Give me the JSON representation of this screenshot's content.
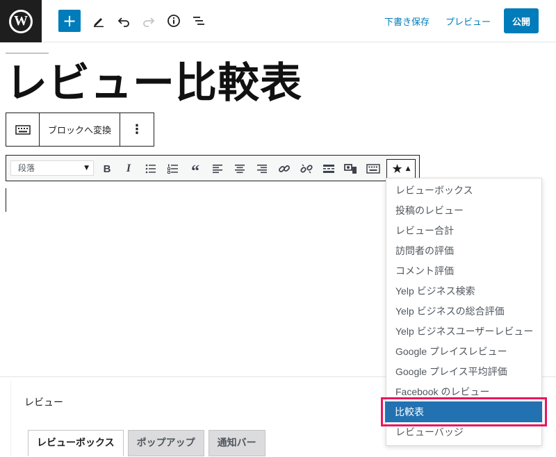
{
  "topbar": {
    "logo": "W",
    "add_icon": "+",
    "save_draft": "下書き保存",
    "preview": "プレビュー",
    "publish": "公開"
  },
  "post": {
    "title": "レビュー比較表"
  },
  "block_toolbar": {
    "transform_label": "ブロックへ変換",
    "more_icon": "⋮"
  },
  "classic_toolbar": {
    "format_select": "段落",
    "bold": "B",
    "italic": "I",
    "quote": "“"
  },
  "review_menu": {
    "items": [
      "レビューボックス",
      "投稿のレビュー",
      "レビュー合計",
      "訪問者の評価",
      "コメント評価",
      "Yelp ビジネス検索",
      "Yelp ビジネスの総合評価",
      "Yelp ビジネスユーザーレビュー",
      "Google プレイスレビュー",
      "Google プレイス平均評価",
      "Facebook のレビュー"
    ],
    "selected": "比較表",
    "after": "レビューバッジ"
  },
  "panel": {
    "label": "レビュー",
    "tabs": [
      "レビューボックス",
      "ポップアップ",
      "通知バー"
    ]
  },
  "colors": {
    "accent": "#007cba",
    "highlight": "#e8175d",
    "selected_bg": "#2271b1"
  }
}
